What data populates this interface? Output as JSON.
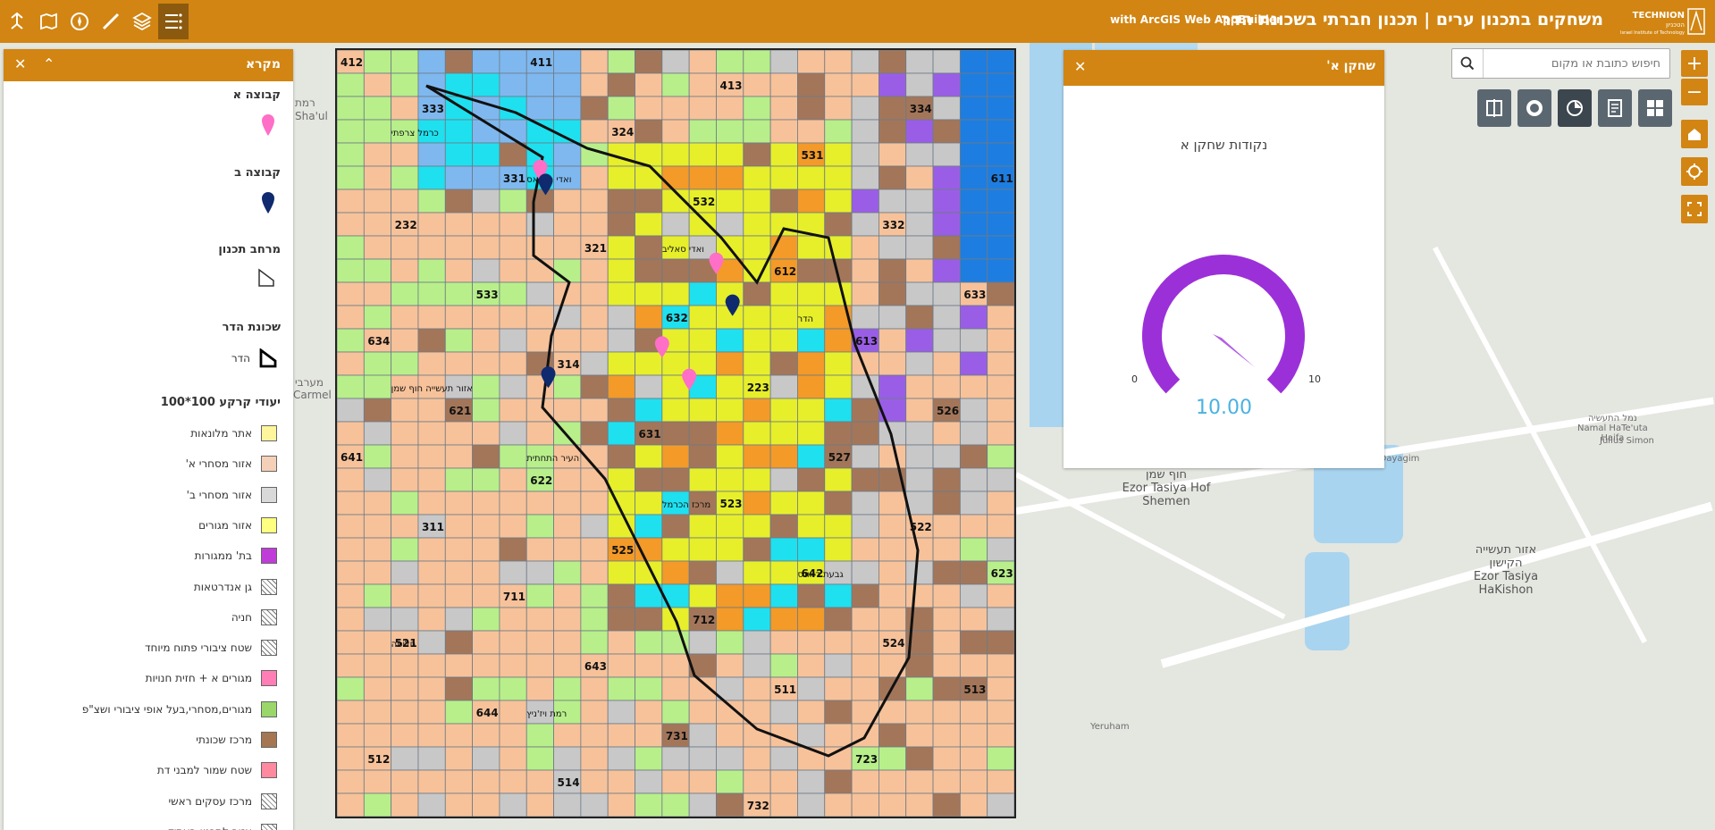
{
  "app": {
    "title": "משחקים בתכנון ערים | תכנון חברתי בשכונת הדר",
    "subtitle": "with ArcGIS Web AppBuilder",
    "brand_color": "#d28512",
    "logo": {
      "name_en": "TECHNION",
      "name_he": "הטכניון",
      "sub_en": "Israel Institute of Technology",
      "sub_he": "מכון טכנולוגי לישראל"
    }
  },
  "toolbar": {
    "icons": [
      "directions-icon",
      "basemap-icon",
      "compass-icon",
      "measure-icon",
      "layers-icon",
      "legend-list-icon"
    ],
    "active": "legend-list-icon"
  },
  "legend": {
    "title": "מקרא",
    "groups": [
      {
        "label": "קבוצה א",
        "symbol": "pin",
        "color": "#ff6ec7"
      },
      {
        "label": "קבוצה ב",
        "symbol": "pin",
        "color": "#0f2a6e"
      },
      {
        "label": "מרחב תכנון",
        "symbol": "polygon-outline"
      },
      {
        "label": "שכונת הדר",
        "symbol": "heading"
      },
      {
        "label": "הדר",
        "symbol": "polygon-outline-bold"
      }
    ],
    "landuse_title": "יעודי קרקע 100*100",
    "landuse": [
      {
        "label": "אתר מלונאות",
        "color": "#fff59d"
      },
      {
        "label": "אזור מסחרי א'",
        "color": "#f5d0b8"
      },
      {
        "label": "אזור מסחרי ב'",
        "color": "#d9d9d9"
      },
      {
        "label": "אזור מגורים",
        "color": "#ffff80"
      },
      {
        "label": "בת' ממגורות",
        "color": "#c03cd9"
      },
      {
        "label": "גן אנדרטאות",
        "color": "hatch"
      },
      {
        "label": "חניה",
        "color": "hatch"
      },
      {
        "label": "שטח ציבורי פתוח מיוחד",
        "color": "hatch"
      },
      {
        "label": "מגורים א + חזית חנויות",
        "color": "#ff7eb6"
      },
      {
        "label": "מגורים,מסחרי,בעל אופי ציבורי ושצ\"פ",
        "color": "#9ad66a"
      },
      {
        "label": "מרכז שכונתי",
        "color": "#a47651"
      },
      {
        "label": "שטח שמור למבני דת",
        "color": "#ff8aa0"
      },
      {
        "label": "מרכז עסקים ראשי",
        "color": "hatch"
      },
      {
        "label": "אזור לתכנון בעתיד",
        "color": "hatch"
      }
    ]
  },
  "search": {
    "placeholder": "חיפוש כתובת או מקום"
  },
  "zoom": {
    "in": "+",
    "out": "−"
  },
  "widgets": [
    "grid-view-icon",
    "report-icon",
    "pie-chart-icon",
    "donut-chart-icon",
    "compare-icon"
  ],
  "gauge_panel": {
    "title": "שחקן א'",
    "label": "נקודות שחקן א",
    "min": 0,
    "max": 10,
    "value": 10.0,
    "value_text": "10.00",
    "arc_color": "#9b30d9",
    "value_color": "#4ab2e0"
  },
  "map": {
    "labels": [
      {
        "text": "רמת",
        "name": "ramat-label"
      },
      {
        "text": "Sha'ul",
        "name": "shaul-label"
      },
      {
        "text": "מערבי",
        "name": "maaravi-label"
      },
      {
        "text": "Carmel",
        "name": "carmel-label"
      },
      {
        "text": "חוף שמן",
        "name": "hof-shemen-he"
      },
      {
        "text": "Ezor Tasiya Hof",
        "name": "hof-shemen-en1"
      },
      {
        "text": "Shemen",
        "name": "hof-shemen-en2"
      },
      {
        "text": "אזור תעשייה",
        "name": "kishon-he1"
      },
      {
        "text": "הקישון",
        "name": "kishon-he2"
      },
      {
        "text": "Ezor Tasiya",
        "name": "kishon-en1"
      },
      {
        "text": "HaKishon",
        "name": "kishon-en2"
      },
      {
        "text": "נמל התעשיה",
        "name": "port-he"
      },
      {
        "text": "Namal HaTe'uta",
        "name": "port-en1"
      },
      {
        "text": "Haifa",
        "name": "port-en2"
      },
      {
        "text": "HaDayagim",
        "name": "dayagim-label"
      },
      {
        "text": "Yeruham",
        "name": "yeruham-label"
      },
      {
        "text": "Julius Simon",
        "name": "simon-label"
      }
    ],
    "grid_labels": [
      "412",
      "411",
      "413",
      "334",
      "333",
      "324",
      "531",
      "611",
      "331",
      "532",
      "332",
      "232",
      "321",
      "612",
      "633",
      "533",
      "632",
      "613",
      "634",
      "314",
      "223",
      "526",
      "621",
      "631",
      "527",
      "641",
      "622",
      "523",
      "522",
      "311",
      "525",
      "642",
      "623",
      "711",
      "712",
      "524",
      "521",
      "643",
      "511",
      "513",
      "644",
      "731",
      "723",
      "512",
      "514",
      "732"
    ],
    "area_labels": [
      "כרמל צרפתי",
      "ואדי ניסנאס",
      "ואדי סאליב",
      "הדר",
      "אזור תעשייה חוף שמן",
      "העיר התחתית",
      "מרכז הכרמל",
      "גבעת דאונס",
      "חליסה",
      "רמת ויז'ניץ"
    ]
  }
}
